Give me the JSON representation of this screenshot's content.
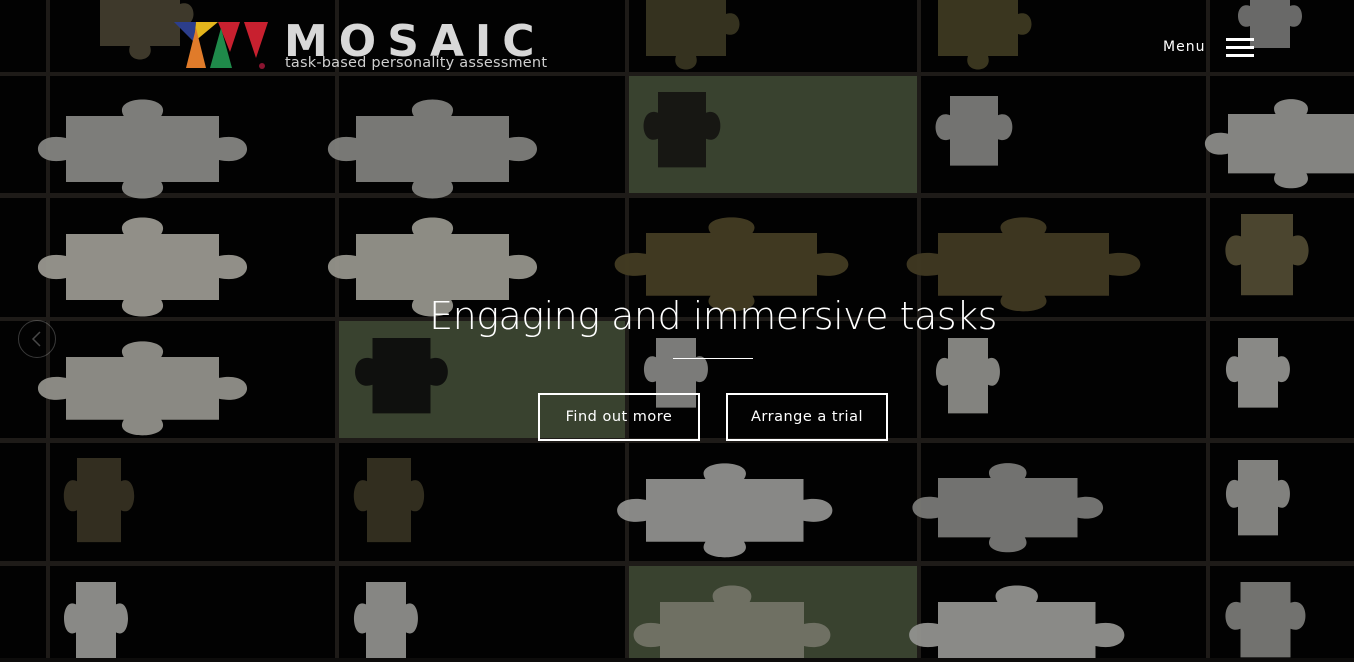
{
  "brand": {
    "name": "MOSAIC",
    "tagline": "task-based personality assessment",
    "mark_colors": [
      "#2c3e8c",
      "#e4b51c",
      "#e07b2a",
      "#1f8a4a",
      "#c8202f"
    ]
  },
  "header": {
    "menu_label": "Menu"
  },
  "hero": {
    "headline": "Engaging and immersive tasks",
    "buttons": {
      "find_out_more": "Find out more",
      "arrange_trial": "Arrange a trial"
    }
  },
  "carousel": {
    "prev_icon": "chevron-left-icon"
  },
  "background": {
    "description_icon": "puzzle-grid",
    "tile_color": "#050505",
    "tile_alt_color": "#4a5a3d",
    "grid_color": "#2a2622"
  }
}
